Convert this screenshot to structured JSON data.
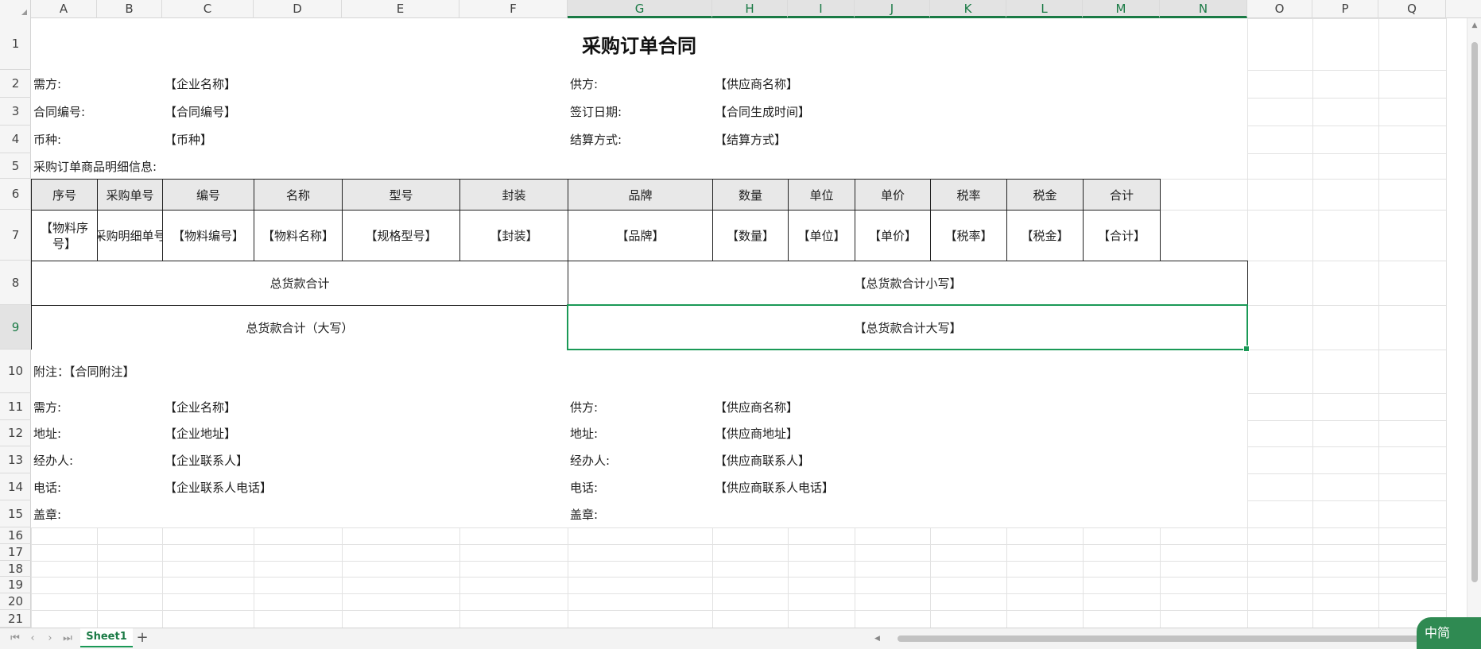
{
  "columns": [
    "A",
    "B",
    "C",
    "D",
    "E",
    "F",
    "G",
    "H",
    "I",
    "J",
    "K",
    "L",
    "M",
    "N",
    "O",
    "P",
    "Q"
  ],
  "selected_columns": [
    "G",
    "H",
    "I",
    "J",
    "K",
    "L",
    "M",
    "N"
  ],
  "rows": [
    "1",
    "2",
    "3",
    "4",
    "5",
    "6",
    "7",
    "8",
    "9",
    "10",
    "11",
    "12",
    "13",
    "14",
    "15",
    "16",
    "17",
    "18",
    "19",
    "20",
    "21"
  ],
  "selected_row": "9",
  "cells": {
    "title": "采购订单合同",
    "r2": {
      "a": "需方:",
      "c": "【企业名称】",
      "g": "供方:",
      "h": "【供应商名称】"
    },
    "r3": {
      "a": "合同编号:",
      "c": "【合同编号】",
      "g": "签订日期:",
      "h": "【合同生成时间】"
    },
    "r4": {
      "a": "币种:",
      "c": "【币种】",
      "g": "结算方式:",
      "h": "【结算方式】"
    },
    "r5": {
      "a": "采购订单商品明细信息:"
    },
    "headers": [
      "序号",
      "采购单号",
      "编号",
      "名称",
      "型号",
      "封装",
      "品牌",
      "数量",
      "单位",
      "单价",
      "税率",
      "税金",
      "合计"
    ],
    "row7": [
      "【物料序号】",
      "【采购明细单号】",
      "【物料编号】",
      "【物料名称】",
      "【规格型号】",
      "【封装】",
      "【品牌】",
      "【数量】",
      "【单位】",
      "【单价】",
      "【税率】",
      "【税金】",
      "【合计】"
    ],
    "r8": {
      "label": "总货款合计",
      "value": "【总货款合计小写】"
    },
    "r9": {
      "label": "总货款合计（大写）",
      "value": "【总货款合计大写】"
    },
    "r10": {
      "a": "附注：【合同附注】"
    },
    "r11": {
      "a": "需方:",
      "c": "【企业名称】",
      "g": "供方:",
      "h": "【供应商名称】"
    },
    "r12": {
      "a": "地址:",
      "c": "【企业地址】",
      "g": "地址:",
      "h": "【供应商地址】"
    },
    "r13": {
      "a": "经办人:",
      "c": "【企业联系人】",
      "g": "经办人:",
      "h": "【供应商联系人】"
    },
    "r14": {
      "a": "电话:",
      "c": "【企业联系人电话】",
      "g": "电话:",
      "h": "【供应商联系人电话】"
    },
    "r15": {
      "a": "盖章:",
      "g": "盖章:"
    }
  },
  "sheet_tab": "Sheet1",
  "add_sheet": "+",
  "ime": "中简",
  "icons": {
    "first": "⏮",
    "prev": "‹",
    "next": "›",
    "last": "⏭"
  }
}
